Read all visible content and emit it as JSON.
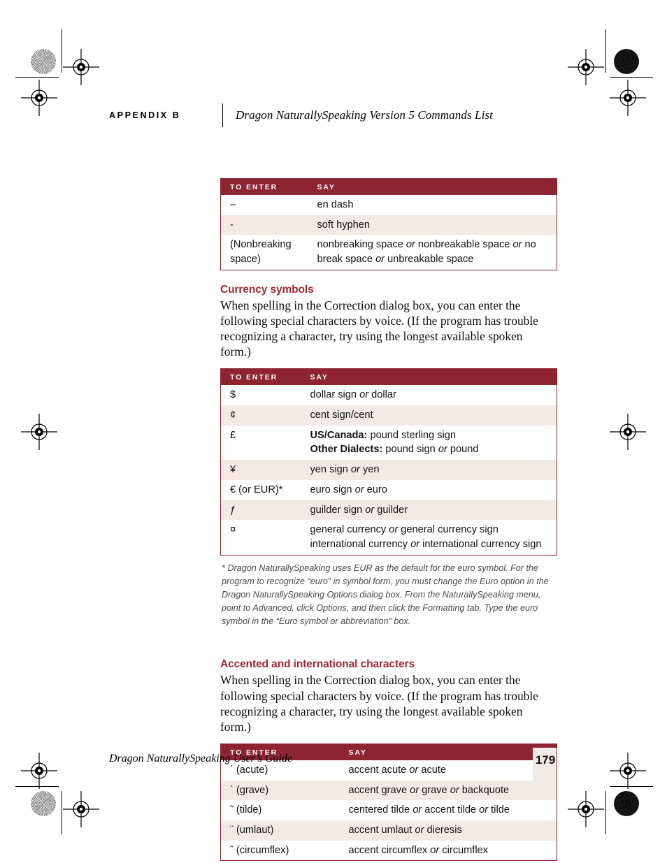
{
  "header": {
    "appendix_label": "APPENDIX B",
    "running_title": "Dragon NaturallySpeaking Version 5 Commands List"
  },
  "colors": {
    "table_header_bg": "#8C2433",
    "row_tint": "#F3EAE8",
    "heading_red": "#9E2A33",
    "page_box": "#F3EAE8"
  },
  "table_headers": {
    "to_enter": "TO ENTER",
    "say": "SAY"
  },
  "dash_table": {
    "rows": [
      {
        "enter": "–",
        "say_parts": [
          {
            "text": "en dash",
            "style": "normal"
          }
        ]
      },
      {
        "enter": "-",
        "say_parts": [
          {
            "text": "soft hyphen",
            "style": "normal"
          }
        ]
      },
      {
        "enter": "(Nonbreaking space)",
        "say_parts": [
          {
            "text": "nonbreaking space ",
            "style": "normal"
          },
          {
            "text": "or",
            "style": "italic"
          },
          {
            "text": " nonbreakable space ",
            "style": "normal"
          },
          {
            "text": "or",
            "style": "italic"
          },
          {
            "text": " no break space ",
            "style": "normal"
          },
          {
            "text": "or",
            "style": "italic"
          },
          {
            "text": " unbreakable space",
            "style": "normal"
          }
        ]
      }
    ]
  },
  "currency_section": {
    "heading": "Currency symbols",
    "body": "When spelling in the Correction dialog box, you can enter the following special characters by voice. (If the program has trouble recognizing a character, try using the longest available spoken form.)"
  },
  "currency_table": {
    "rows": [
      {
        "enter": "$",
        "say_parts": [
          {
            "text": "dollar sign ",
            "style": "normal"
          },
          {
            "text": "or",
            "style": "italic"
          },
          {
            "text": " dollar",
            "style": "normal"
          }
        ]
      },
      {
        "enter": "¢",
        "say_parts": [
          {
            "text": "cent sign/cent",
            "style": "normal"
          }
        ]
      },
      {
        "enter": "£",
        "say_parts": [
          {
            "text": "US/Canada:",
            "style": "bold"
          },
          {
            "text": " pound sterling sign",
            "style": "normal"
          },
          {
            "text": "\n",
            "style": "break"
          },
          {
            "text": "Other Dialects:",
            "style": "bold"
          },
          {
            "text": " pound sign ",
            "style": "normal"
          },
          {
            "text": "or",
            "style": "italic"
          },
          {
            "text": " pound",
            "style": "normal"
          }
        ]
      },
      {
        "enter": "¥",
        "say_parts": [
          {
            "text": "yen sign ",
            "style": "normal"
          },
          {
            "text": "or",
            "style": "italic"
          },
          {
            "text": " yen",
            "style": "normal"
          }
        ]
      },
      {
        "enter": "€ (or EUR)*",
        "say_parts": [
          {
            "text": "euro sign ",
            "style": "normal"
          },
          {
            "text": "or",
            "style": "italic"
          },
          {
            "text": " euro",
            "style": "normal"
          }
        ]
      },
      {
        "enter": "ƒ",
        "say_parts": [
          {
            "text": "guilder sign ",
            "style": "normal"
          },
          {
            "text": "or",
            "style": "italic"
          },
          {
            "text": " guilder",
            "style": "normal"
          }
        ]
      },
      {
        "enter": "¤",
        "say_parts": [
          {
            "text": "general currency ",
            "style": "normal"
          },
          {
            "text": "or",
            "style": "italic"
          },
          {
            "text": " general currency sign",
            "style": "normal"
          },
          {
            "text": "\n",
            "style": "break"
          },
          {
            "text": "international currency ",
            "style": "normal"
          },
          {
            "text": "or",
            "style": "italic"
          },
          {
            "text": " international currency sign",
            "style": "normal"
          }
        ]
      }
    ]
  },
  "currency_footnote": "* Dragon NaturallySpeaking uses EUR as the default for the euro symbol. For the program to recognize “euro” in symbol form, you must change the Euro option in the Dragon NaturallySpeaking Options dialog box. From the NaturallySpeaking menu, point to Advanced, click Options, and then click the Formatting tab. Type the euro symbol in the “Euro symbol or abbreviation” box.",
  "accent_section": {
    "heading": "Accented and international characters",
    "body": "When spelling in the Correction dialog box, you can enter the following special characters by voice. (If the program has trouble recognizing a character, try using the longest available spoken form.)"
  },
  "accent_table": {
    "rows": [
      {
        "enter": "´ (acute)",
        "say_parts": [
          {
            "text": "accent acute ",
            "style": "normal"
          },
          {
            "text": "or",
            "style": "italic"
          },
          {
            "text": " acute",
            "style": "normal"
          }
        ]
      },
      {
        "enter": "` (grave)",
        "say_parts": [
          {
            "text": "accent grave ",
            "style": "normal"
          },
          {
            "text": "or",
            "style": "italic"
          },
          {
            "text": " grave ",
            "style": "normal"
          },
          {
            "text": "or",
            "style": "italic"
          },
          {
            "text": " backquote",
            "style": "normal"
          }
        ]
      },
      {
        "enter": "˜ (tilde)",
        "say_parts": [
          {
            "text": "centered tilde ",
            "style": "normal"
          },
          {
            "text": "or",
            "style": "italic"
          },
          {
            "text": " accent tilde ",
            "style": "normal"
          },
          {
            "text": "or",
            "style": "italic"
          },
          {
            "text": " tilde",
            "style": "normal"
          }
        ]
      },
      {
        "enter": "¨ (umlaut)",
        "say_parts": [
          {
            "text": "accent umlaut ",
            "style": "normal"
          },
          {
            "text": "or",
            "style": "italic"
          },
          {
            "text": " dieresis",
            "style": "normal"
          }
        ]
      },
      {
        "enter": "ˆ (circumflex)",
        "say_parts": [
          {
            "text": "accent circumflex ",
            "style": "normal"
          },
          {
            "text": "or",
            "style": "italic"
          },
          {
            "text": " circumflex",
            "style": "normal"
          }
        ]
      }
    ]
  },
  "footer": {
    "title": "Dragon NaturallySpeaking User’s Guide",
    "page_number": "179"
  }
}
